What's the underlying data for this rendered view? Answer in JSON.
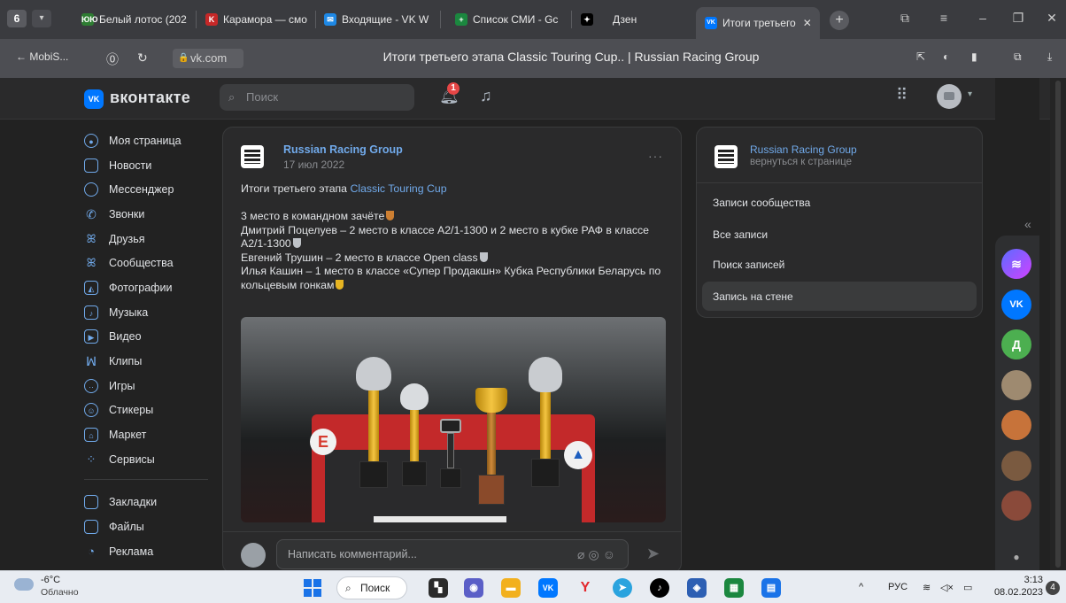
{
  "browser": {
    "tab_count": "6",
    "tabs": [
      {
        "label": "Белый лотос (202",
        "favicon_color": "#2e7d32",
        "favicon_text": "ЮЮ"
      },
      {
        "label": "Карамора — смо",
        "favicon_color": "#c62828",
        "favicon_text": "K"
      },
      {
        "label": "Входящие - VK W",
        "favicon_color": "#1e88e5",
        "favicon_text": "✉"
      },
      {
        "label": "Список СМИ - Gc",
        "favicon_color": "#1b873f",
        "favicon_text": "+"
      },
      {
        "label": "Дзен",
        "favicon_color": "#000000",
        "favicon_text": "✦"
      },
      {
        "label": "Итоги третьего",
        "favicon_color": "#0077ff",
        "favicon_text": "VK"
      }
    ],
    "back_label": "MobiS...",
    "url": "vk.com",
    "page_title": "Итоги третьего этапа Classic Touring Cup.. | Russian Racing Group"
  },
  "vk": {
    "brand": "вконтакте",
    "logo_text": "VK",
    "search_placeholder": "Поиск",
    "notification_count": "1",
    "nav": [
      {
        "label": "Моя страница",
        "icon": "user-circle-icon"
      },
      {
        "label": "Новости",
        "icon": "news-icon"
      },
      {
        "label": "Мессенджер",
        "icon": "message-icon"
      },
      {
        "label": "Звонки",
        "icon": "phone-icon"
      },
      {
        "label": "Друзья",
        "icon": "friends-icon"
      },
      {
        "label": "Сообщества",
        "icon": "communities-icon"
      },
      {
        "label": "Фотографии",
        "icon": "photo-icon"
      },
      {
        "label": "Музыка",
        "icon": "music-icon"
      },
      {
        "label": "Видео",
        "icon": "video-icon"
      },
      {
        "label": "Клипы",
        "icon": "clips-icon"
      },
      {
        "label": "Игры",
        "icon": "games-icon"
      },
      {
        "label": "Стикеры",
        "icon": "stickers-icon"
      },
      {
        "label": "Маркет",
        "icon": "market-icon"
      },
      {
        "label": "Сервисы",
        "icon": "services-icon"
      }
    ],
    "nav_secondary": [
      {
        "label": "Закладки",
        "icon": "bookmark-icon"
      },
      {
        "label": "Файлы",
        "icon": "file-icon"
      },
      {
        "label": "Реклама",
        "icon": "ads-icon"
      }
    ]
  },
  "post": {
    "group_name": "Russian Racing Group",
    "date": "17 июл 2022",
    "intro_prefix": "Итоги третьего этапа ",
    "intro_link": "Classic Touring Cup",
    "line1": "3 место в командном зачёте",
    "line2": "Дмитрий Поцелуев – 2 место в классе А2/1-1300 и 2 место в кубке РАФ в классе",
    "line2b": "А2/1-1300",
    "line3": "Евгений Трушин – 2 место в классе Open class",
    "line4": "Илья Кашин – 1 место в классе «Супер Продакшн» Кубка Республики Беларусь по",
    "line4b": "кольцевым гонкам",
    "comment_placeholder": "Написать комментарий...",
    "medal_colors": {
      "bronze": "#cd7f32",
      "silver": "#bfc3c8",
      "gold": "#e6b422"
    }
  },
  "side": {
    "group_name": "Russian Racing Group",
    "back_link": "вернуться к странице",
    "links": [
      "Записи сообщества",
      "Все записи",
      "Поиск записей",
      "Запись на стене"
    ]
  },
  "side_panel": {
    "icons": [
      {
        "name": "alice-icon",
        "color": "#8a4dff",
        "text": "≋"
      },
      {
        "name": "vk-app-icon",
        "color": "#0077ff",
        "text": "VK"
      },
      {
        "name": "d-avatar-icon",
        "color": "#4caf50",
        "text": "Д"
      },
      {
        "name": "avatar-1-icon",
        "color": "#9e8a70",
        "text": ""
      },
      {
        "name": "avatar-2-icon",
        "color": "#c7733a",
        "text": ""
      },
      {
        "name": "avatar-3-icon",
        "color": "#7a5a40",
        "text": ""
      },
      {
        "name": "avatar-4-icon",
        "color": "#8a4a3a",
        "text": ""
      }
    ]
  },
  "taskbar": {
    "temperature": "-6°C",
    "weather": "Облачно",
    "search_label": "Поиск",
    "lang": "РУС",
    "time": "3:13",
    "date": "08.02.2023",
    "notifications": "4"
  }
}
